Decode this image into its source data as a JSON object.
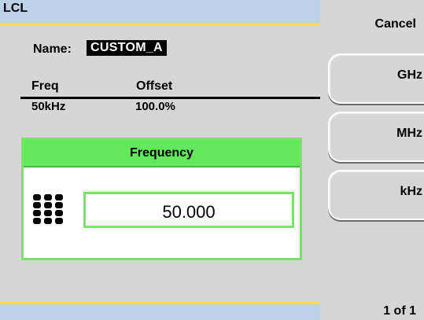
{
  "header": {
    "title": "LCL"
  },
  "profile": {
    "name_label": "Name:",
    "name_value": "CUSTOM_A"
  },
  "table": {
    "columns": [
      "Freq",
      "Offset"
    ],
    "rows": [
      {
        "freq": "50kHz",
        "offset": "100.0%"
      }
    ]
  },
  "dialog": {
    "title": "Frequency",
    "value": "50.000",
    "icon": "keypad-icon"
  },
  "softkeys": {
    "cancel": "Cancel",
    "ghz": "GHz",
    "mhz": "MHz",
    "khz": "kHz",
    "page": "1 of 1"
  },
  "colors": {
    "title_bar": "#bcd2e8",
    "title_border": "#f4e04a",
    "dialog_header": "#62e85a",
    "dialog_border": "#7ee06c",
    "background": "#d6d6d6"
  }
}
